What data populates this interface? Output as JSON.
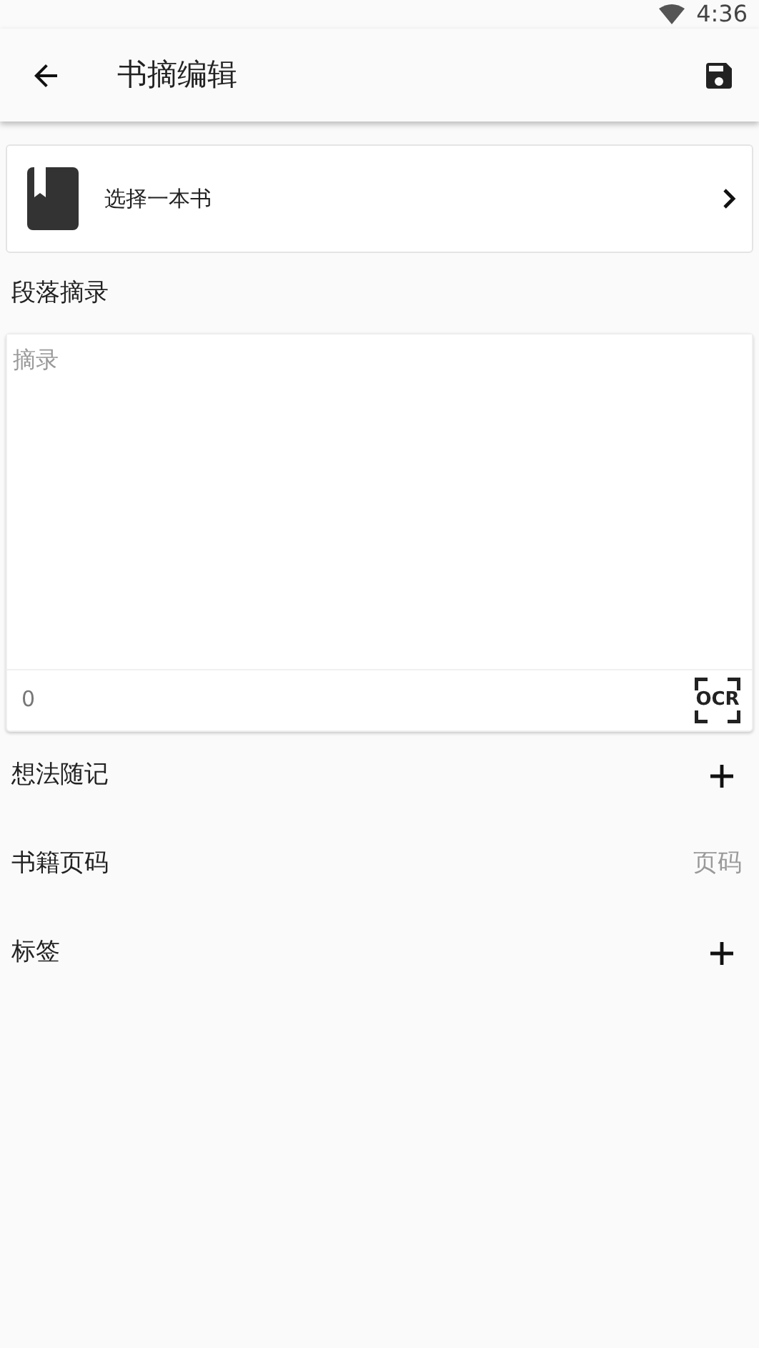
{
  "status_bar": {
    "time": "4:36"
  },
  "app_bar": {
    "title": "书摘编辑"
  },
  "book_picker": {
    "label": "选择一本书"
  },
  "excerpt": {
    "heading": "段落摘录",
    "placeholder": "摘录",
    "count": "0",
    "ocr_label": "OCR"
  },
  "rows": [
    {
      "kind": "add",
      "label": "想法随记"
    },
    {
      "kind": "input",
      "label": "书籍页码",
      "placeholder": "页码"
    },
    {
      "kind": "add",
      "label": "标签"
    }
  ]
}
